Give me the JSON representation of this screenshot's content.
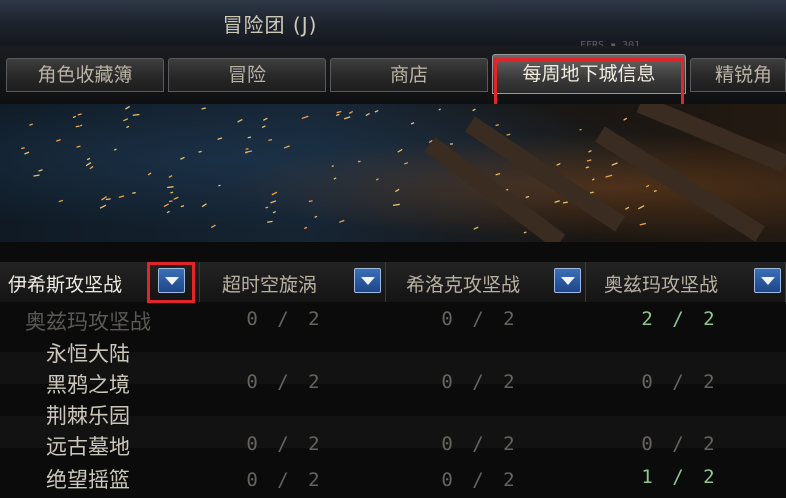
{
  "window": {
    "title": "冒险团 (J)",
    "deco": "FFRS ▪ 301"
  },
  "tabs": [
    {
      "label": "角色收藏簿",
      "active": false
    },
    {
      "label": "冒险",
      "active": false
    },
    {
      "label": "商店",
      "active": false
    },
    {
      "label": "每周地下城信息",
      "active": true
    },
    {
      "label": "精锐角",
      "active": false
    }
  ],
  "table": {
    "columns": [
      "伊希斯攻坚战",
      "超时空旋涡",
      "希洛克攻坚战",
      "奥兹玛攻坚战"
    ],
    "rows": [
      {
        "label": "奥兹玛攻坚战",
        "values": [
          "0 / 2",
          "0 / 2",
          "2 / 2"
        ]
      },
      {
        "label": "永恒大陆"
      },
      {
        "label": "黑鸦之境",
        "values": [
          "0 / 2",
          "0 / 2",
          "0 / 2"
        ]
      },
      {
        "label": "荆棘乐园"
      },
      {
        "label": "远古墓地",
        "values": [
          "0 / 2",
          "0 / 2",
          "0 / 2"
        ]
      },
      {
        "label": "绝望摇篮",
        "values": [
          "0 / 2",
          "0 / 2",
          "1 / 2"
        ]
      }
    ]
  },
  "colors": {
    "highlight": "#e0262a",
    "complete": "#8fc78d",
    "pending": "#67645d",
    "dropdown": "#2c5aa0"
  },
  "icons": {
    "dropdown": "triangle-down-icon"
  }
}
